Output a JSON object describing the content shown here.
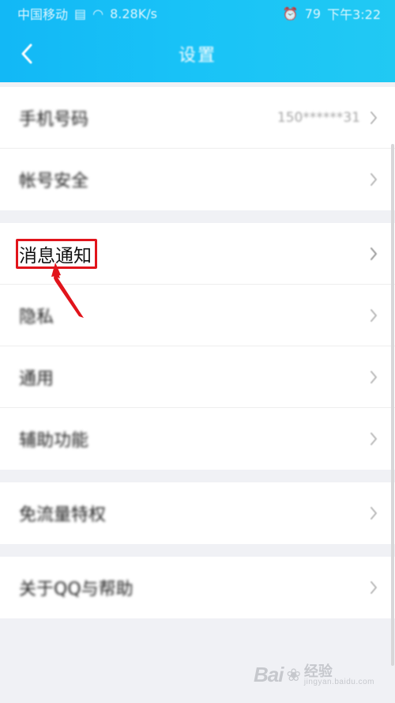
{
  "status_bar": {
    "carrier": "中国移动",
    "speed": "8.28K/s",
    "time": "下午3:22",
    "battery": "79"
  },
  "nav": {
    "title": "设置",
    "back_icon": "chevron-left-icon"
  },
  "groups": [
    {
      "items": [
        {
          "label": "手机号码",
          "value": "150******31"
        },
        {
          "label": "帐号安全"
        }
      ]
    },
    {
      "items": [
        {
          "label": "消息通知",
          "highlighted": true
        },
        {
          "label": "隐私"
        },
        {
          "label": "通用"
        },
        {
          "label": "辅助功能"
        }
      ]
    },
    {
      "items": [
        {
          "label": "免流量特权"
        }
      ]
    },
    {
      "items": [
        {
          "label": "关于QQ与帮助"
        }
      ]
    }
  ],
  "annotation": {
    "highlight_color": "#e1141b"
  },
  "watermark": {
    "logo": "Bai",
    "text": "经验",
    "url": "jingyan.baidu.com"
  },
  "colors": {
    "header_start": "#12b8f6",
    "header_end": "#21c9f3",
    "background": "#f0f1f5"
  }
}
